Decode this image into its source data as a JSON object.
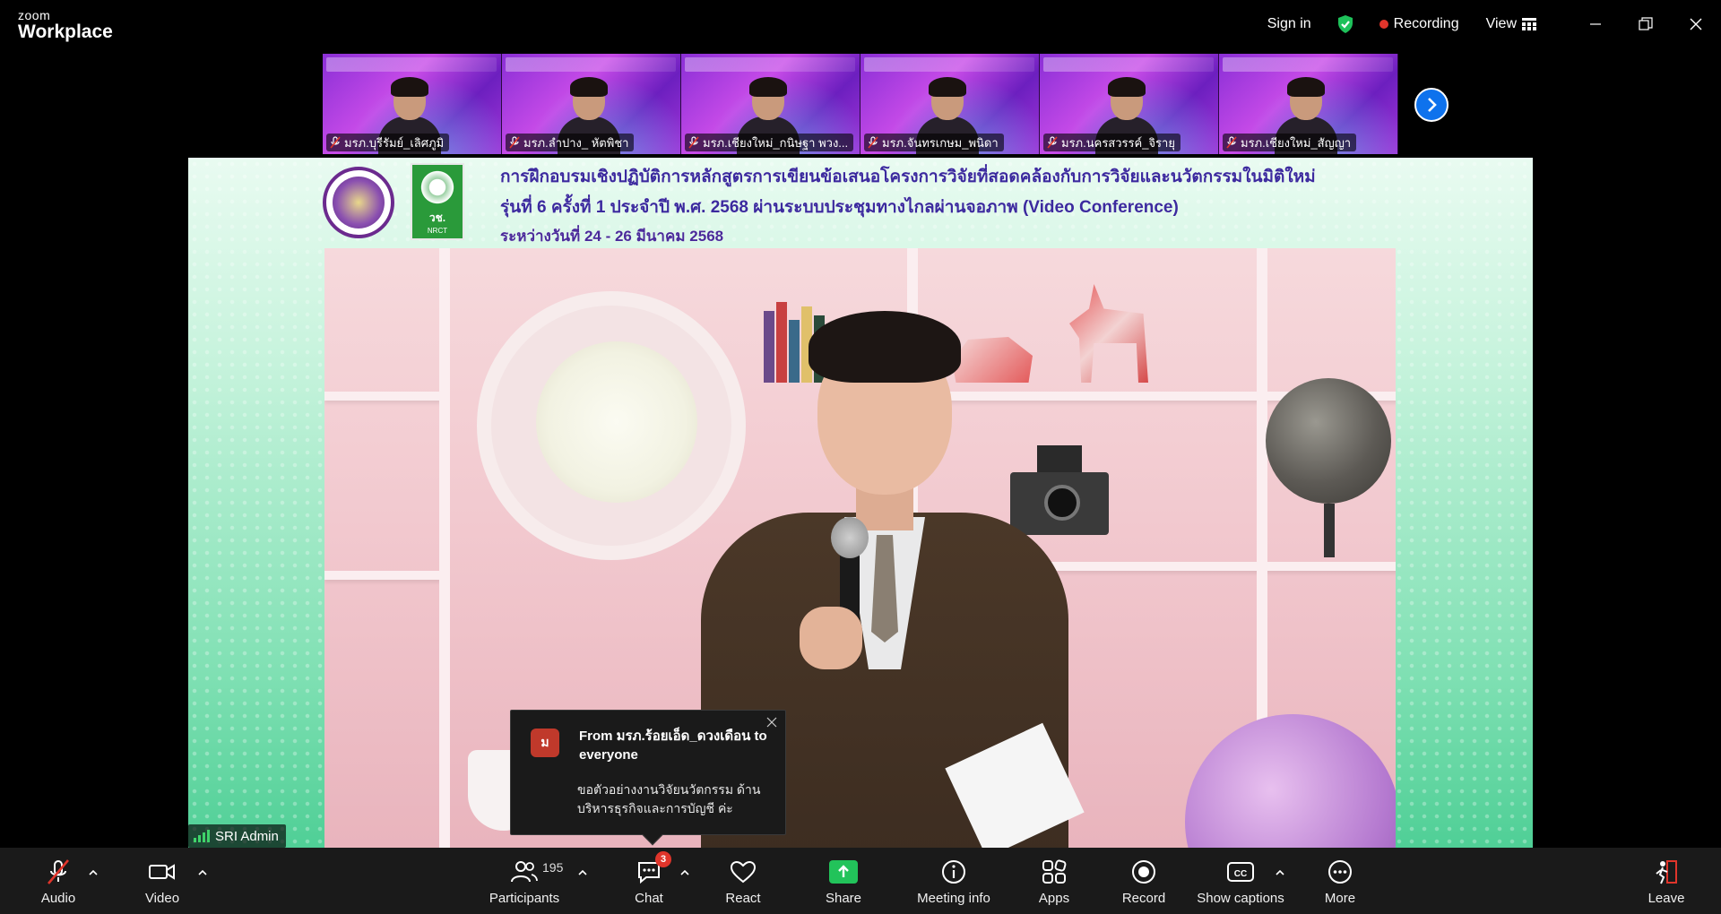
{
  "app": {
    "brand_small": "zoom",
    "brand_big": "Workplace"
  },
  "titlebar": {
    "sign_in": "Sign in",
    "recording": "Recording",
    "view": "View",
    "icons": {
      "security": "shield-check-icon",
      "view": "grid-icon",
      "minimize": "minimize-icon",
      "restore": "restore-icon",
      "close": "close-icon"
    },
    "colors": {
      "shield": "#1ec15a",
      "recording_dot": "#e0352b"
    }
  },
  "participants_strip": [
    {
      "name": "มรภ.บุรีรัมย์_เลิศภูมิ",
      "muted": true
    },
    {
      "name": "มรภ.ลำปาง_ หัตพิชา",
      "muted": true
    },
    {
      "name": "มรภ.เชียงใหม่_กนิษฐา พวง...",
      "muted": true
    },
    {
      "name": "มรภ.จันทรเกษม_พนิดา",
      "muted": true
    },
    {
      "name": "มรภ.นครสวรรค์_จิรายุ",
      "muted": true
    },
    {
      "name": "มรภ.เชียงใหม่_สัญญา",
      "muted": true
    }
  ],
  "main_video": {
    "heading_line1": "การฝึกอบรมเชิงปฏิบัติการหลักสูตรการเขียนข้อเสนอโครงการวิจัยที่สอดคล้องกับการวิจัยและนวัตกรรมในมิติใหม่",
    "heading_line2": "รุ่นที่ 6 ครั้งที่ 1 ประจำปี พ.ศ. 2568 ผ่านระบบประชุมทางไกลผ่านจอภาพ (Video Conference)",
    "heading_line3": "ระหว่างวันที่ 24 - 26 มีนาคม 2568",
    "logo2_text": "วช.",
    "logo2_sub": "NRCT",
    "speaker_label": "SRI Admin"
  },
  "chat_popup": {
    "avatar_letter": "ม",
    "from": "From มรภ.ร้อยเอ็ด_ดวงเดือน to everyone",
    "message": "ขอตัวอย่างงานวิจัยนวัตกรรม ด้านบริหารธุรกิจและการบัญชี ค่ะ"
  },
  "toolbar": {
    "audio": "Audio",
    "video": "Video",
    "participants": "Participants",
    "participants_count": "195",
    "chat": "Chat",
    "chat_badge": "3",
    "react": "React",
    "share": "Share",
    "meeting_info": "Meeting info",
    "apps": "Apps",
    "record": "Record",
    "captions": "Show captions",
    "more": "More",
    "leave": "Leave"
  }
}
